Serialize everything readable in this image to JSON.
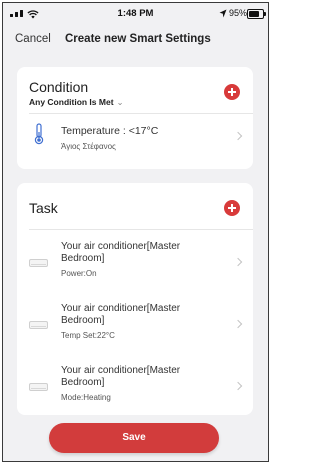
{
  "status_bar": {
    "time": "1:48 PM",
    "battery_text": "95%",
    "battery_level": 0.95
  },
  "nav": {
    "cancel_label": "Cancel",
    "title": "Create new Smart Settings"
  },
  "condition": {
    "title": "Condition",
    "mode_label": "Any Condition Is Met",
    "mode_caret": "⌄",
    "item": {
      "main": "Temperature : <17°C",
      "location": "Άγιος Στέφανος"
    }
  },
  "task": {
    "title": "Task",
    "items": [
      {
        "name_line1": "Your air conditioner[Master",
        "name_line2": "Bedroom]",
        "action": "Power:On"
      },
      {
        "name_line1": "Your air conditioner[Master",
        "name_line2": "Bedroom]",
        "action": "Temp Set:22°C"
      },
      {
        "name_line1": "Your air conditioner[Master",
        "name_line2": "Bedroom]",
        "action": "Mode:Heating"
      }
    ]
  },
  "save_label": "Save",
  "colors": {
    "accent": "#d83a3a",
    "background": "#f1f1f3",
    "card": "#ffffff"
  },
  "icons": [
    "signal-icon",
    "wifi-icon",
    "location-arrow-icon",
    "battery-icon",
    "add-icon",
    "thermometer-icon",
    "air-conditioner-icon",
    "chevron-right-icon"
  ]
}
